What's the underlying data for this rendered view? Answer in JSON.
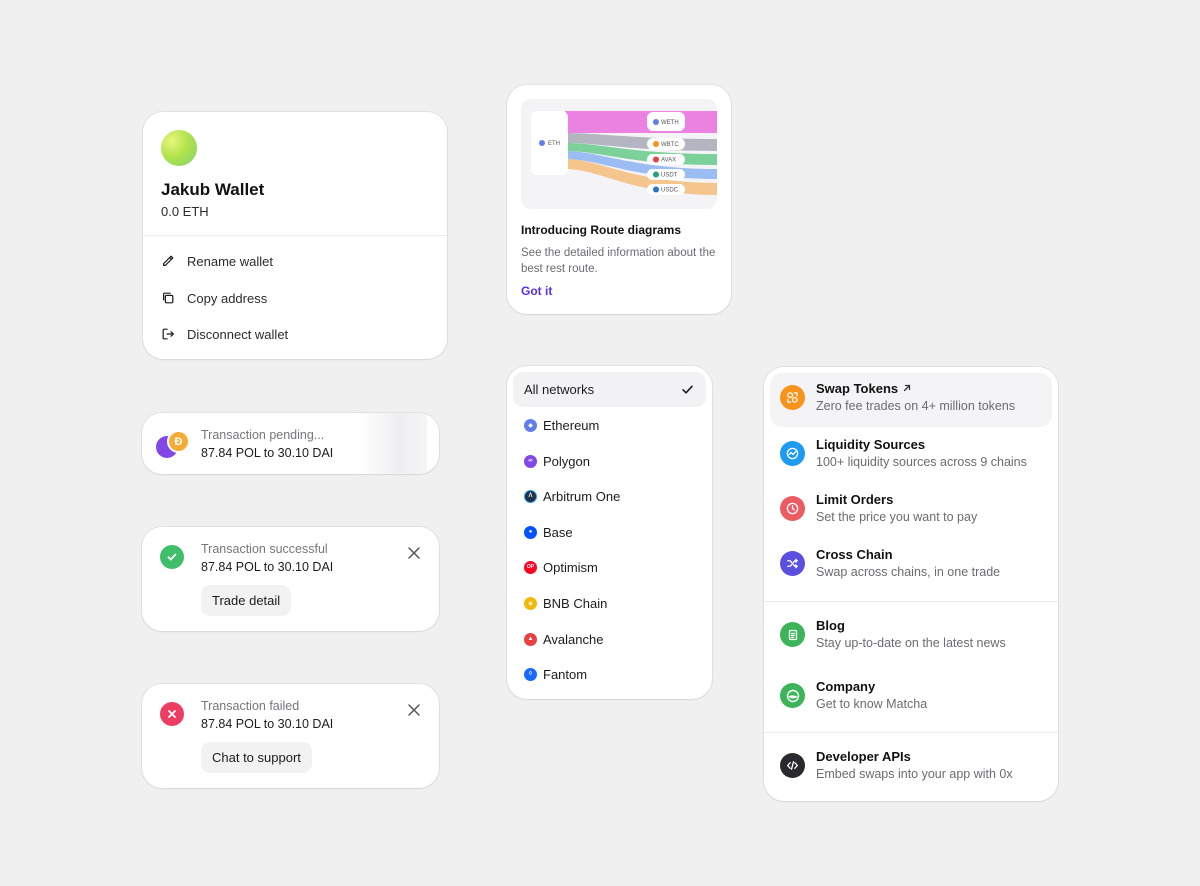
{
  "wallet": {
    "name": "Jakub Wallet",
    "balance": "0.0 ETH",
    "menu": [
      {
        "label": "Rename wallet",
        "icon": "pencil-icon"
      },
      {
        "label": "Copy address",
        "icon": "copy-icon"
      },
      {
        "label": "Disconnect wallet",
        "icon": "logout-icon"
      }
    ]
  },
  "route_promo": {
    "title": "Introducing Route diagrams",
    "description": "See the detailed information about the best rest route.",
    "link": "Got it",
    "diagram": {
      "source": "ETH",
      "targets": [
        "WETH",
        "WBTC",
        "AVAX",
        "USDT",
        "USDC"
      ]
    }
  },
  "transactions": {
    "pending": {
      "status": "Transaction pending...",
      "amount": "87.84 POL to 30.10 DAI"
    },
    "success": {
      "status": "Transaction successful",
      "amount": "87.84 POL to 30.10 DAI",
      "action": "Trade detail"
    },
    "failed": {
      "status": "Transaction failed",
      "amount": "87.84 POL to 30.10 DAI",
      "action": "Chat to support"
    }
  },
  "networks": {
    "selected": "All networks",
    "items": [
      {
        "label": "Ethereum",
        "color": "#627eea"
      },
      {
        "label": "Polygon",
        "color": "#8247e5"
      },
      {
        "label": "Arbitrum One",
        "color": "#213147"
      },
      {
        "label": "Base",
        "color": "#0052ff"
      },
      {
        "label": "Optimism",
        "color": "#ff0420"
      },
      {
        "label": "BNB Chain",
        "color": "#f0b90b"
      },
      {
        "label": "Avalanche",
        "color": "#e84142"
      },
      {
        "label": "Fantom",
        "color": "#1969ff"
      }
    ]
  },
  "products": {
    "items": [
      {
        "title": "Swap Tokens",
        "subtitle": "Zero fee trades on 4+ million tokens",
        "icon": "swap-icon",
        "color": "#f7931a"
      },
      {
        "title": "Liquidity Sources",
        "subtitle": "100+ liquidity sources across 9 chains",
        "icon": "liquidity-icon",
        "color": "#1e9bf0"
      },
      {
        "title": "Limit Orders",
        "subtitle": "Set the price you want to pay",
        "icon": "clock-icon",
        "color": "#ec5b62"
      },
      {
        "title": "Cross Chain",
        "subtitle": "Swap across chains, in one trade",
        "icon": "shuffle-icon",
        "color": "#5b4fe0"
      },
      {
        "title": "Blog",
        "subtitle": "Stay up-to-date on the latest news",
        "icon": "document-icon",
        "color": "#3db45a"
      },
      {
        "title": "Company",
        "subtitle": "Get to know Matcha",
        "icon": "matcha-logo-icon",
        "color": "#3db45a"
      },
      {
        "title": "Developer APIs",
        "subtitle": "Embed swaps into your app with 0x",
        "icon": "code-icon",
        "color": "#2a2a2e"
      }
    ]
  }
}
